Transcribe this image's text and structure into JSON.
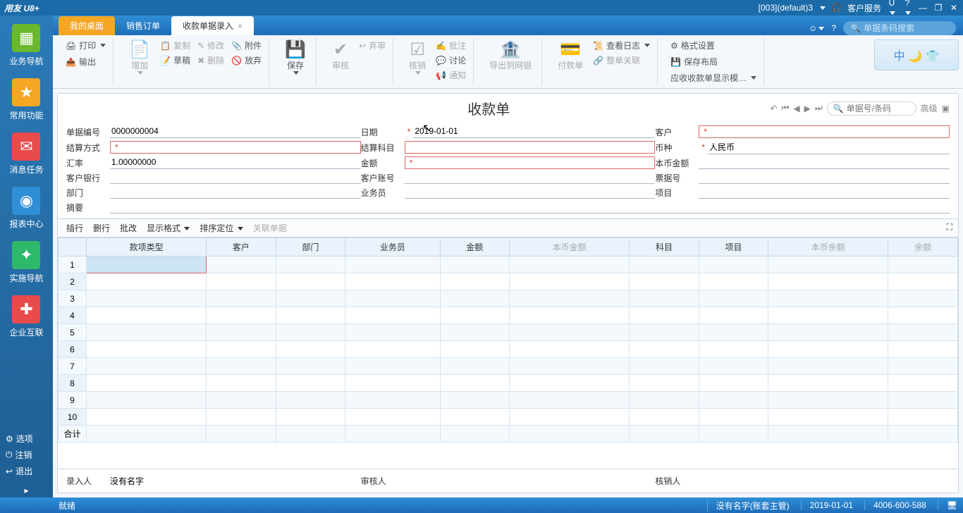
{
  "titlebar": {
    "logo": "用友 U8+",
    "session": "[003](default)3",
    "service": "客户服务"
  },
  "sidebar": {
    "items": [
      {
        "label": "业务导航",
        "icon": "▦",
        "cls": "g"
      },
      {
        "label": "常用功能",
        "icon": "★",
        "cls": "o"
      },
      {
        "label": "消息任务",
        "icon": "✉",
        "cls": "r"
      },
      {
        "label": "报表中心",
        "icon": "◉",
        "cls": "b"
      },
      {
        "label": "实施导航",
        "icon": "✦",
        "cls": "grn"
      },
      {
        "label": "企业互联",
        "icon": "✚",
        "cls": "rd"
      }
    ],
    "links": [
      {
        "label": "选项",
        "icon": "⚙"
      },
      {
        "label": "注销",
        "icon": "⏻"
      },
      {
        "label": "退出",
        "icon": "↩"
      }
    ]
  },
  "tabs": {
    "items": [
      "我的桌面",
      "销售订单"
    ],
    "active": "收款单据录入",
    "search_ph": "单据条码搜索"
  },
  "ribbon": {
    "g1": [
      "打印",
      "输出"
    ],
    "g2_big": "增加",
    "g2": [
      "复制",
      "草稿",
      "修改",
      "删除",
      "附件",
      "放弃"
    ],
    "g3_big": "保存",
    "g4_big": "审核",
    "g4": [
      "弃审"
    ],
    "g5_big": "核销",
    "g5": [
      "批注",
      "讨论",
      "通知"
    ],
    "g6_big": "导出到网银",
    "g7_big": "付款单",
    "g7": [
      "查看日志",
      "整单关联"
    ],
    "g8": [
      "格式设置",
      "保存布局",
      "应收收款单显示模…"
    ]
  },
  "doc": {
    "title": "收款单",
    "search_ph": "单据号/条码",
    "adv": "高级",
    "form": {
      "no_label": "单据编号",
      "no": "0000000004",
      "date_label": "日期",
      "date": "2019-01-01",
      "cust_label": "客户",
      "cust": "",
      "settle_label": "结算方式",
      "settle": "",
      "subj_label": "结算科目",
      "subj": "",
      "curr_label": "币种",
      "curr": "人民币",
      "rate_label": "汇率",
      "rate": "1.00000000",
      "amt_label": "金额",
      "amt": "",
      "local_label": "本币金额",
      "local": "",
      "bank_label": "客户银行",
      "bank": "",
      "acct_label": "客户账号",
      "acct": "",
      "bill_label": "票据号",
      "bill": "",
      "dept_label": "部门",
      "dept": "",
      "staff_label": "业务员",
      "staff": "",
      "proj_label": "项目",
      "proj": "",
      "memo_label": "摘要",
      "memo": ""
    },
    "gridbar": {
      "ins": "插行",
      "del": "删行",
      "batch": "批改",
      "fmt": "显示格式",
      "sort": "排序定位",
      "rel": "关联单据"
    },
    "cols": [
      "款项类型",
      "客户",
      "部门",
      "业务员",
      "金额",
      "本币金额",
      "科目",
      "项目",
      "本币余额",
      "余额"
    ],
    "total": "合计",
    "foot": {
      "entry_l": "录入人",
      "entry": "没有名字",
      "audit_l": "审核人",
      "cancel_l": "核销人"
    }
  },
  "status": {
    "ready": "就绪",
    "user": "没有名字(账套主管)",
    "date": "2019-01-01",
    "tel": "4006-600-588"
  }
}
